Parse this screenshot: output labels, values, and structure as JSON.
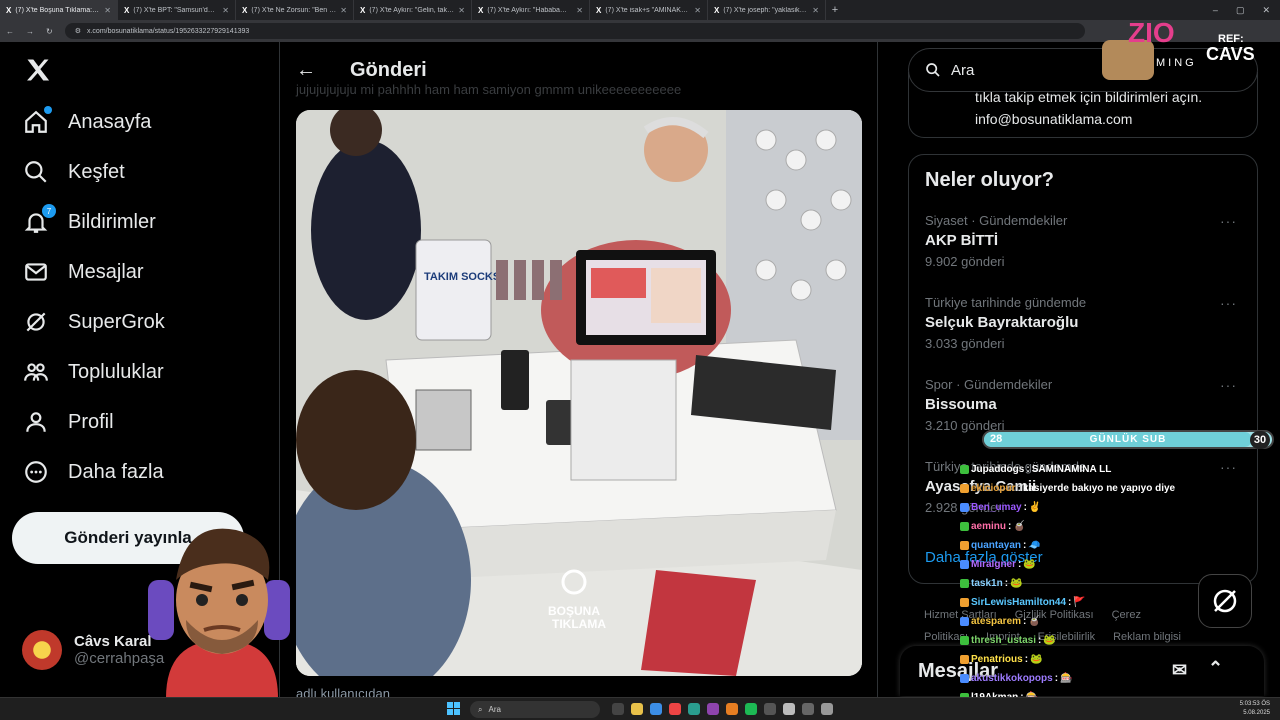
{
  "browser": {
    "tabs": [
      {
        "title": "(7) X'te Boşuna Tıklama: \"Ir",
        "active": true
      },
      {
        "title": "(7) X'te BPT: \"Samsun'da ilginç",
        "active": false
      },
      {
        "title": "(7) X'te Ne Zorsun: \"Ben bir ory",
        "active": false
      },
      {
        "title": "(7) X'te Aykırı: \"Gelin, takı merai",
        "active": false
      },
      {
        "title": "(7) X'te Aykırı: \"Hababam sınıfı",
        "active": false
      },
      {
        "title": "(7) X'te isak+s \"AMINAKOYAYIM",
        "active": false
      },
      {
        "title": "(7) X'te joseph: \"yaklasik 4-5 sa",
        "active": false
      }
    ],
    "new_tab": "+",
    "url": "x.com/bosunatiklama/status/1952633227929141393",
    "window_controls": [
      "–",
      "▢",
      "✕"
    ]
  },
  "nav": {
    "items": [
      {
        "label": "Anasayfa",
        "icon": "home-icon"
      },
      {
        "label": "Keşfet",
        "icon": "search-icon"
      },
      {
        "label": "Bildirimler",
        "icon": "bell-icon",
        "badge": "7"
      },
      {
        "label": "Mesajlar",
        "icon": "mail-icon"
      },
      {
        "label": "SuperGrok",
        "icon": "grok-icon"
      },
      {
        "label": "Topluluklar",
        "icon": "communities-icon"
      },
      {
        "label": "Profil",
        "icon": "person-icon"
      },
      {
        "label": "Daha fazla",
        "icon": "more-icon"
      }
    ],
    "post_button": "Gönderi yayınla",
    "profile": {
      "name": "Câvs Karal",
      "handle": "@cerrahpaşa"
    }
  },
  "post": {
    "back": "←",
    "title": "Gönderi",
    "ghost_text": "jujujujujuju mi pahhhh ham ham samiyon gmmm unikeeeeeeeeeee",
    "media_watermark_line1": "BOŞUNA",
    "media_watermark_line2": "TIKLAMA",
    "bag_text": "TAKIM SOCKS",
    "caption": "adlı kullanıcıdan"
  },
  "right": {
    "search_placeholder": "Ara",
    "info_line1": "tıkla takip etmek için bildirimleri açın.",
    "info_line2": "info@bosunatiklama.com",
    "trends_title": "Neler oluyor?",
    "trends": [
      {
        "category": "Siyaset · Gündemdekiler",
        "name": "AKP BİTTİ",
        "count": "9.902 gönderi"
      },
      {
        "category": "Türkiye tarihinde gündemde",
        "name": "Selçuk Bayraktaroğlu",
        "count": "3.033 gönderi"
      },
      {
        "category": "Spor · Gündemdekiler",
        "name": "Bissouma",
        "count": "3.210 gönderi"
      },
      {
        "category": "Türkiye tarihinde gündemde",
        "name": "Ayasofya Camii",
        "count": "2.928 gönderi"
      }
    ],
    "more_dots": "···",
    "show_more": "Daha fazla göster",
    "footer": [
      "Hizmet Şartları",
      "Gizlilik Politikası",
      "Çerez Politikası",
      "Imprint",
      "Erişilebilirlik",
      "Reklam bilgisi"
    ],
    "messages_title": "Mesajlar"
  },
  "overlay": {
    "logo_text": "ZIO",
    "logo_sub": "MING",
    "ref_label": "REF:",
    "ref_name": "CAVS",
    "sub_left": "28",
    "sub_title": "GÜNLÜK SUB",
    "sub_right": "30",
    "sub_progress": 0.93,
    "chat": [
      {
        "user": "Jupaddogs",
        "msg": "SAMINAMINA LL",
        "color": "#ffffff"
      },
      {
        "user": "ekiciopur",
        "msg": "kasiyerde bakıyo ne yapıyo diye",
        "color": "#e8a33c"
      },
      {
        "user": "Ben_umay",
        "msg": "✌",
        "color": "#9b59ff"
      },
      {
        "user": "aeminu",
        "msg": "🧉",
        "color": "#ff6fa8"
      },
      {
        "user": "quantayan",
        "msg": "🧢",
        "color": "#4aa3ff"
      },
      {
        "user": "Miralgner",
        "msg": "🐸",
        "color": "#b06cff"
      },
      {
        "user": "task1n",
        "msg": "🐸",
        "color": "#8ad1ff"
      },
      {
        "user": "SirLewisHamilton44",
        "msg": "🚩",
        "color": "#5ac8ff"
      },
      {
        "user": "atesparem",
        "msg": "🧉",
        "color": "#f4c542"
      },
      {
        "user": "thresh_ustasi",
        "msg": "🐸",
        "color": "#7dd36b"
      },
      {
        "user": "Penatrious",
        "msg": "🐸",
        "color": "#ffe14a"
      },
      {
        "user": "akustikkokopops",
        "msg": "🎰",
        "color": "#9d7bff"
      },
      {
        "user": "l19Akman",
        "msg": "🎰",
        "color": "#ffffff"
      }
    ]
  },
  "taskbar": {
    "search": "Ara",
    "time": "5:03:53 ÖS",
    "date": "5.08.2025"
  }
}
